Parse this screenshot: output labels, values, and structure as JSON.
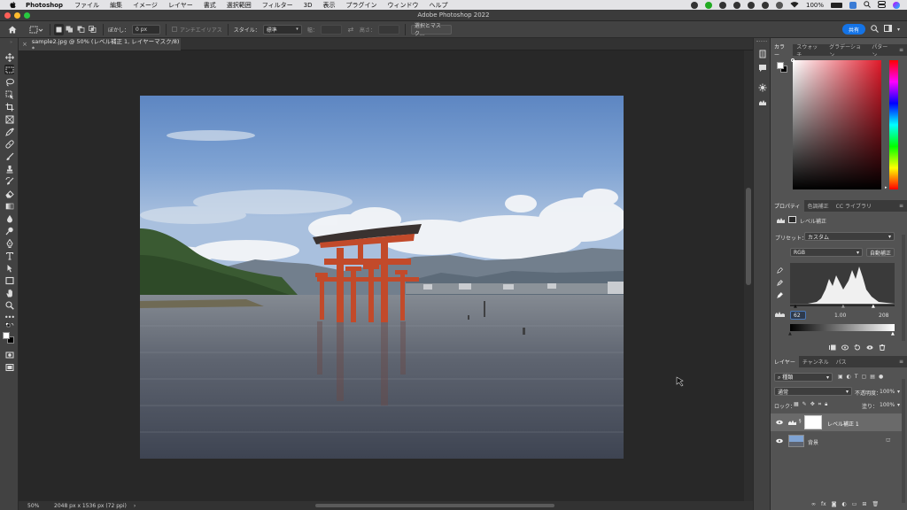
{
  "menubar": {
    "app": "Photoshop",
    "items": [
      "ファイル",
      "編集",
      "イメージ",
      "レイヤー",
      "書式",
      "選択範囲",
      "フィルター",
      "3D",
      "表示",
      "プラグイン",
      "ウィンドウ",
      "ヘルプ"
    ],
    "battery": "100%"
  },
  "window": {
    "title": "Adobe Photoshop 2022"
  },
  "options": {
    "feather_label": "ぼかし：",
    "feather_value": "0 px",
    "antialias": "アンチエイリアス",
    "style_label": "スタイル：",
    "style_value": "標準",
    "width_label": "幅：",
    "height_label": "高さ：",
    "select_mask": "選択とマスク...",
    "share": "共有"
  },
  "document": {
    "tab_title": "sample2.jpg @ 50% (レベル補正 1, レイヤーマスク/8) *",
    "zoom": "50%",
    "info": "2048 px x 1536 px (72 ppi)"
  },
  "color_panel": {
    "tabs": [
      "カラー",
      "スウォッチ",
      "グラデーション",
      "パターン"
    ]
  },
  "properties_panel": {
    "tabs": [
      "プロパティ",
      "色調補正",
      "CC ライブラリ"
    ],
    "layer_type": "レベル補正",
    "preset_label": "プリセット：",
    "preset_value": "カスタム",
    "channel": "RGB",
    "auto": "自動補正",
    "input_black": "62",
    "input_gamma": "1.00",
    "input_white": "208"
  },
  "layers_panel": {
    "tabs": [
      "レイヤー",
      "チャンネル",
      "パス"
    ],
    "filter": "種類",
    "blend_mode": "通常",
    "opacity_label": "不透明度：",
    "opacity": "100%",
    "lock_label": "ロック：",
    "fill_label": "塗り：",
    "fill": "100%",
    "layers": [
      {
        "name": "レベル補正 1"
      },
      {
        "name": "背景"
      }
    ]
  },
  "colors": {
    "accent": "#1473e6",
    "torii": "#c24a2a"
  }
}
